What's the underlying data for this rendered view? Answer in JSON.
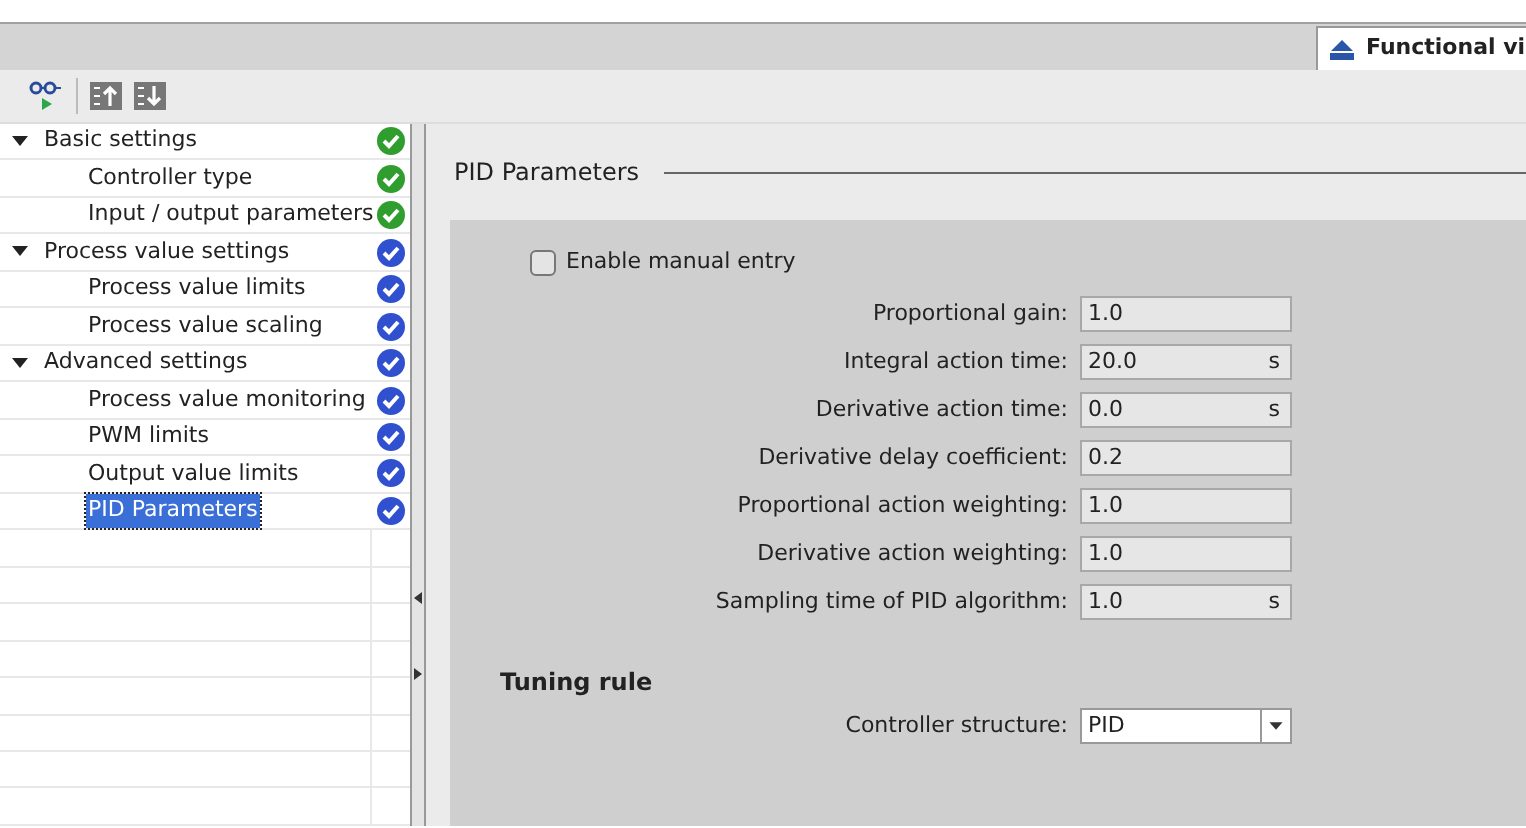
{
  "tab": {
    "label": "Functional vi",
    "selected": true
  },
  "nav": [
    {
      "label": "Basic settings",
      "expanded": true,
      "color": "#2f9e2f",
      "selected": false,
      "children": [
        {
          "label": "Controller type",
          "color": "#2f9e2f",
          "selected": false
        },
        {
          "label": "Input / output parameters",
          "color": "#2f9e2f",
          "selected": false
        }
      ]
    },
    {
      "label": "Process value settings",
      "expanded": true,
      "color": "#3050d0",
      "selected": false,
      "children": [
        {
          "label": "Process value limits",
          "color": "#3050d0",
          "selected": false
        },
        {
          "label": "Process value scaling",
          "color": "#3050d0",
          "selected": false
        }
      ]
    },
    {
      "label": "Advanced settings",
      "expanded": true,
      "color": "#3050d0",
      "selected": false,
      "children": [
        {
          "label": "Process value monitoring",
          "color": "#3050d0",
          "selected": false
        },
        {
          "label": "PWM limits",
          "color": "#3050d0",
          "selected": false
        },
        {
          "label": "Output value limits",
          "color": "#3050d0",
          "selected": false
        },
        {
          "label": "PID Parameters",
          "color": "#3050d0",
          "selected": true
        }
      ]
    }
  ],
  "section": {
    "title": "PID Parameters",
    "manual_entry": {
      "label": "Enable manual entry",
      "checked": false
    },
    "fields": [
      {
        "label": "Proportional gain:",
        "value": "1.0"
      },
      {
        "label": "Integral action time:",
        "value": "20.0",
        "unit": "s"
      },
      {
        "label": "Derivative action time:",
        "value": "0.0",
        "unit": "s"
      },
      {
        "label": "Derivative delay coefficient:",
        "value": "0.2"
      },
      {
        "label": "Proportional action weighting:",
        "value": "1.0"
      },
      {
        "label": "Derivative action weighting:",
        "value": "1.0"
      },
      {
        "label": "Sampling time of PID algorithm:",
        "value": "1.0",
        "unit": "s"
      }
    ],
    "tuning": {
      "title": "Tuning rule",
      "label": "Controller structure:",
      "value": "PID"
    }
  }
}
